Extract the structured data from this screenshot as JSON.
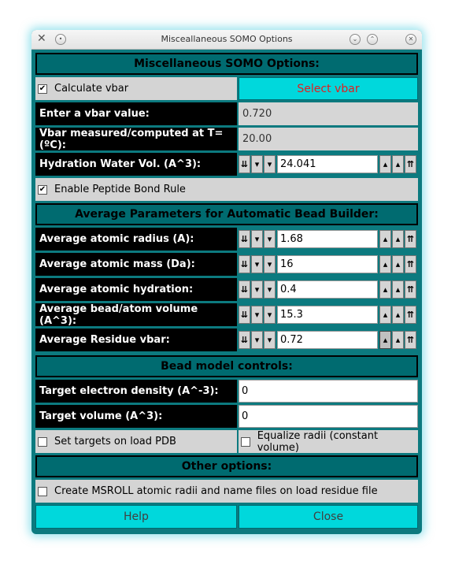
{
  "window": {
    "title": "Misceallaneous SOMO Options",
    "app_icon": "tools-icon",
    "controls": [
      "minimize-icon",
      "maximize-icon",
      "close-icon"
    ]
  },
  "section_main": {
    "title": "Miscellaneous SOMO Options:",
    "calc_vbar": {
      "label": "Calculate vbar",
      "checked": true
    },
    "select_vbar_button": "Select vbar",
    "vbar_label": "Enter a vbar value:",
    "vbar_value": "0.720",
    "temp_label": "Vbar measured/computed at T=(ºC):",
    "temp_value": "20.00",
    "hydration_label": "Hydration Water Vol. (A^3):",
    "hydration_value": "24.041",
    "peptide_rule": {
      "label": "Enable Peptide Bond Rule",
      "checked": true
    }
  },
  "section_avg": {
    "title": "Average Parameters for Automatic Bead Builder:",
    "rows": [
      {
        "label": "Average atomic radius (A):",
        "value": "1.68"
      },
      {
        "label": "Average atomic mass (Da):",
        "value": "16"
      },
      {
        "label": "Average atomic hydration:",
        "value": "0.4"
      },
      {
        "label": "Average bead/atom volume (A^3):",
        "value": "15.3"
      },
      {
        "label": "Average Residue vbar:",
        "value": "0.72"
      }
    ]
  },
  "section_bead": {
    "title": "Bead model controls:",
    "density_label": "Target electron density (A^-3):",
    "density_value": "0",
    "volume_label": "Target volume (A^3):",
    "volume_value": "0",
    "set_targets": {
      "label": "Set targets on load PDB",
      "checked": false
    },
    "equalize": {
      "label": "Equalize radii (constant volume)",
      "checked": false
    }
  },
  "section_other": {
    "title": "Other options:",
    "msroll": {
      "label": "Create MSROLL atomic radii and name files on load residue file",
      "checked": false
    }
  },
  "footer": {
    "help_button": "Help",
    "close_button": "Close"
  },
  "spinner_glyphs": {
    "down_triple": "⇊",
    "down_double": "▾",
    "down_single": "▾",
    "up_single": "▴",
    "up_double": "▴",
    "up_triple": "⇈"
  },
  "colors": {
    "frame": "#0c7a7f",
    "header": "#006b70",
    "button": "#00d8dc",
    "select_text": "#e02020"
  }
}
